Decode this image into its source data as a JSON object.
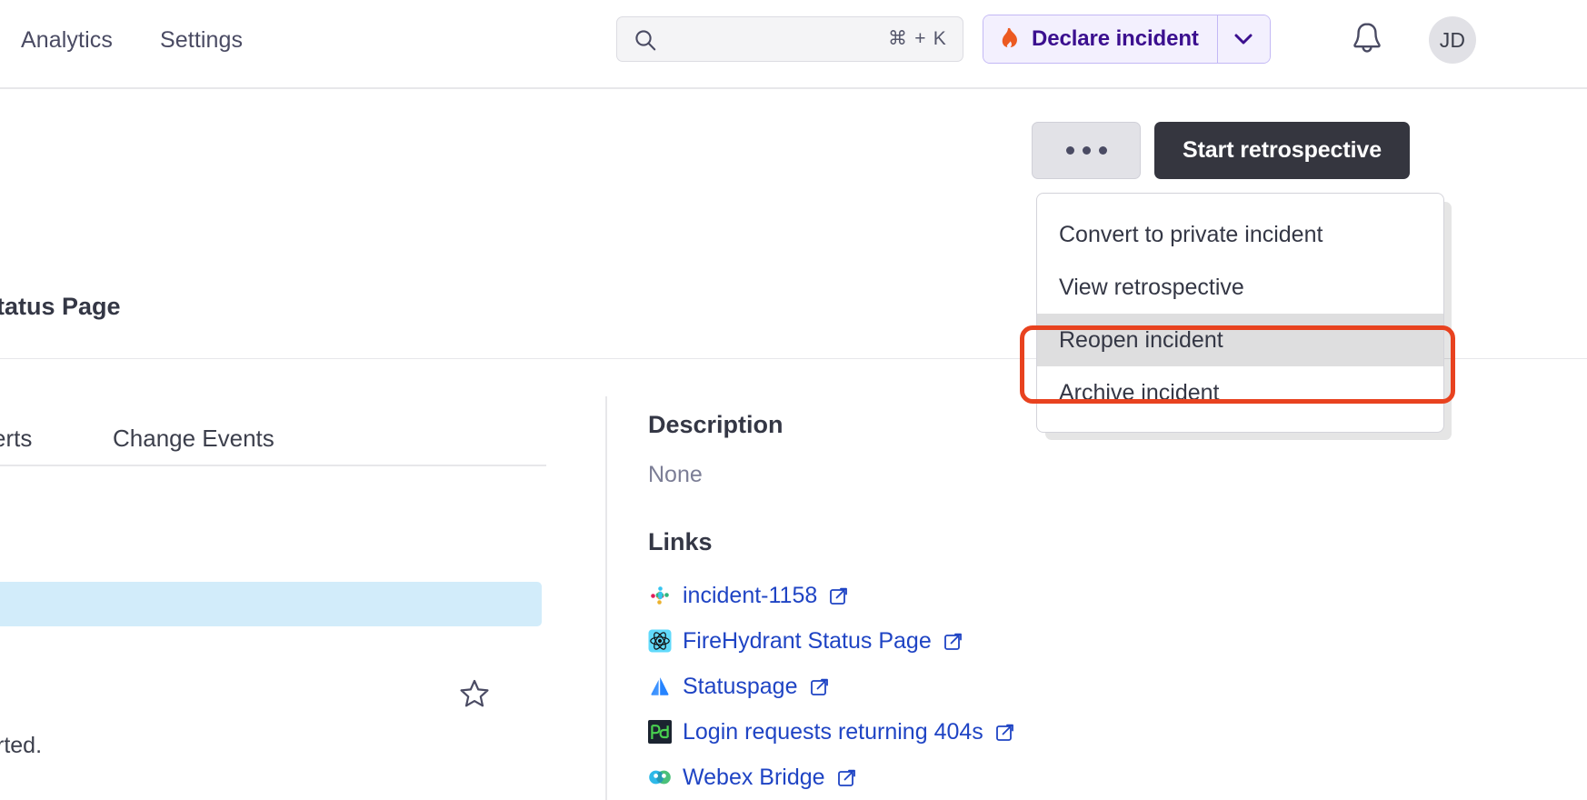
{
  "topnav": {
    "links": [
      {
        "label": "Analytics"
      },
      {
        "label": "Settings"
      }
    ],
    "search": {
      "placeholder": "",
      "value": "",
      "shortcut": "⌘ + K",
      "icon": "search-icon"
    },
    "declare": {
      "label": "Declare incident",
      "icon": "flame-icon",
      "caret_icon": "chevron-down-icon",
      "accent": "#3b0f8f",
      "background": "#f3f0fe",
      "border": "#c3b8f5"
    },
    "notifications": {
      "icon": "bell-icon"
    },
    "avatar": {
      "initials": "JD",
      "background": "#e1e1e6"
    }
  },
  "actionbar": {
    "more_label": "•••",
    "more_icon": "ellipsis-icon",
    "start_retrospective_label": "Start retrospective",
    "start_retrospective_bg": "#35363f"
  },
  "actions_menu": {
    "items": [
      {
        "label": "Convert to private incident",
        "highlighted": false
      },
      {
        "label": "View retrospective",
        "highlighted": false
      },
      {
        "label": "Reopen incident",
        "highlighted": true
      },
      {
        "label": "Archive incident",
        "highlighted": false
      }
    ],
    "highlight_background": "#dededf"
  },
  "annotation": {
    "target": "Reopen incident",
    "color": "#e8421f"
  },
  "page": {
    "title_partial": "tatus Page",
    "tabs": [
      {
        "label": "erts"
      },
      {
        "label": "Change Events"
      }
    ],
    "timeline_text_partial": "rted.",
    "highlight_band_color": "#d2ecfa",
    "star_icon": "star-outline-icon"
  },
  "details": {
    "description_heading": "Description",
    "description_value": "None",
    "links_heading": "Links",
    "links": [
      {
        "label": "incident-1158",
        "favicon": "slack-icon"
      },
      {
        "label": "FireHydrant Status Page",
        "favicon": "firehydrant-atom-icon"
      },
      {
        "label": "Statuspage",
        "favicon": "atlassian-statuspage-icon"
      },
      {
        "label": "Login requests returning 404s",
        "favicon": "pagerduty-icon"
      },
      {
        "label": "Webex Bridge",
        "favicon": "webex-icon"
      }
    ],
    "link_color": "#1f44c4",
    "external_icon": "external-link-icon"
  }
}
